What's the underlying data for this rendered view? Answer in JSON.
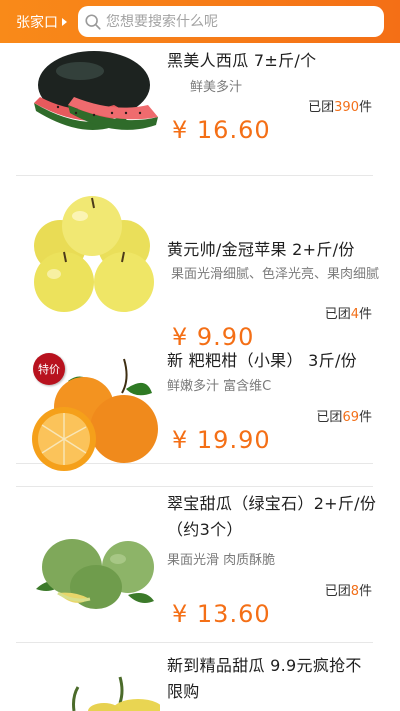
{
  "header": {
    "city": "张家口",
    "search_placeholder": "您想要搜索什么呢"
  },
  "products": [
    {
      "title": "黑美人西瓜    7±斤/个",
      "desc": "鲜美多汁",
      "sold_prefix": "已团",
      "sold_count": "390",
      "sold_suffix": "件",
      "price": "¥ 16.60"
    },
    {
      "title": "黄元帅/金冠苹果  2+斤/份",
      "desc": "果面光滑细腻、色泽光亮、果肉细腻",
      "sold_prefix": "已团",
      "sold_count": "4",
      "sold_suffix": "件",
      "price": "¥ 9.90"
    },
    {
      "title": "新 粑粑柑（小果）   3斤/份",
      "desc": "鲜嫩多汁   富含维C",
      "sold_prefix": "已团",
      "sold_count": "69",
      "sold_suffix": "件",
      "price": "¥ 19.90",
      "tag": "特价"
    },
    {
      "title": "翠宝甜瓜（绿宝石）2+斤/份（约3个）",
      "desc": "果面光滑   肉质酥脆",
      "sold_prefix": "已团",
      "sold_count": "8",
      "sold_suffix": "件",
      "price": "¥ 13.60"
    },
    {
      "title": "新到精品甜瓜  9.9元疯抢不限购",
      "desc": ""
    }
  ],
  "colors": {
    "accent": "#f46f16",
    "tag": "#b8121e"
  }
}
